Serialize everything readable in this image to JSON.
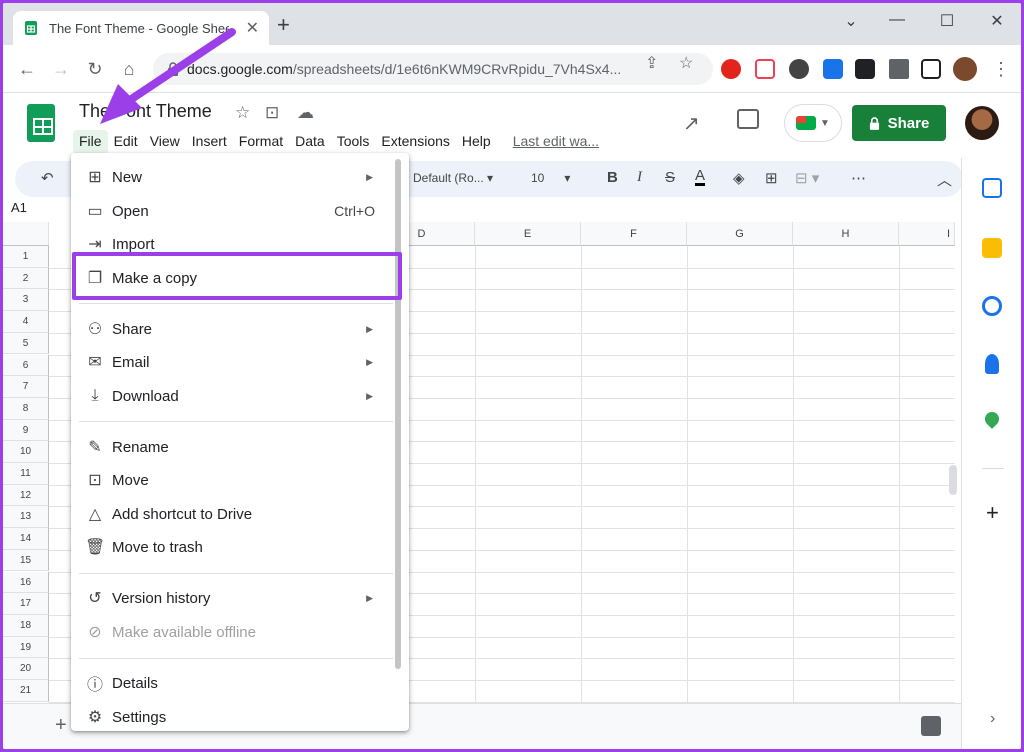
{
  "browser": {
    "tab_title": "The Font Theme - Google Sheets",
    "url_domain": "docs.google.com",
    "url_path": "/spreadsheets/d/1e6t6nKWM9CRvRpidu_7Vh4Sx4..."
  },
  "sheets": {
    "doc_title": "The Font Theme",
    "menu": [
      "File",
      "Edit",
      "View",
      "Insert",
      "Format",
      "Data",
      "Tools",
      "Extensions",
      "Help"
    ],
    "last_edit": "Last edit wa...",
    "share_label": "Share",
    "font": "Default (Ro...",
    "font_size": "10",
    "cell_ref": "A1",
    "columns": [
      "D",
      "E",
      "F",
      "G",
      "H",
      "I"
    ],
    "rows": [
      "1",
      "2",
      "3",
      "4",
      "5",
      "6",
      "7",
      "8",
      "9",
      "10",
      "11",
      "12",
      "13",
      "14",
      "15",
      "16",
      "17",
      "18",
      "19",
      "20",
      "21"
    ]
  },
  "file_menu": {
    "new": "New",
    "open": "Open",
    "open_shortcut": "Ctrl+O",
    "import": "Import",
    "make_copy": "Make a copy",
    "share": "Share",
    "email": "Email",
    "download": "Download",
    "rename": "Rename",
    "move": "Move",
    "add_shortcut": "Add shortcut to Drive",
    "move_to_trash": "Move to trash",
    "version_history": "Version history",
    "make_offline": "Make available offline",
    "details": "Details",
    "settings": "Settings"
  },
  "colors": {
    "annotation": "#9b3fe8",
    "share_button": "#188038",
    "sheets_green": "#0f9d58"
  },
  "icons": [
    "sheets-logo-icon",
    "star-icon",
    "move-folder-icon",
    "cloud-status-icon",
    "trend-icon",
    "comment-icon",
    "meet-icon",
    "lock-icon",
    "undo-icon"
  ]
}
